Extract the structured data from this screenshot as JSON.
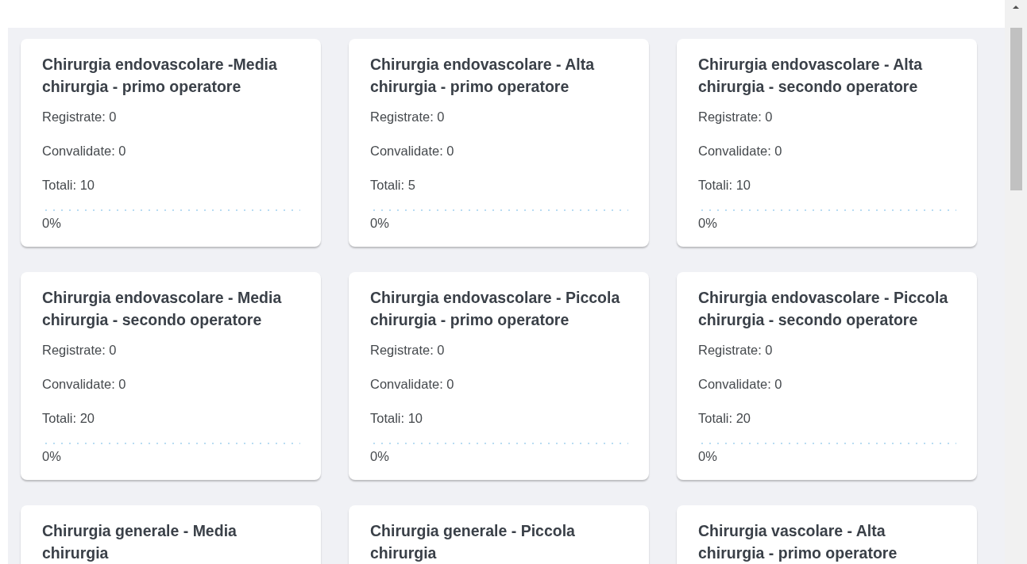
{
  "cards": [
    {
      "title": "Chirurgia endovascolare -Media chirurgia - primo operatore",
      "registrate": "Registrate: 0",
      "convalidate": "Convalidate: 0",
      "totali": "Totali: 10",
      "level": 0,
      "percent": "0%"
    },
    {
      "title": "Chirurgia endovascolare - Alta chirurgia - primo operatore",
      "registrate": "Registrate: 0",
      "convalidate": "Convalidate: 0",
      "totali": "Totali: 5",
      "level": 0,
      "percent": "0%"
    },
    {
      "title": "Chirurgia endovascolare - Alta chirurgia - secondo operatore",
      "registrate": "Registrate: 0",
      "convalidate": "Convalidate: 0",
      "totali": "Totali: 10",
      "level": 0,
      "percent": "0%"
    },
    {
      "title": "Chirurgia endovascolare - Media chirurgia - secondo operatore",
      "registrate": "Registrate: 0",
      "convalidate": "Convalidate: 0",
      "totali": "Totali: 20",
      "level": 0,
      "percent": "0%"
    },
    {
      "title": "Chirurgia endovascolare - Piccola chirurgia - primo operatore",
      "registrate": "Registrate: 0",
      "convalidate": "Convalidate: 0",
      "totali": "Totali: 10",
      "level": 0,
      "percent": "0%"
    },
    {
      "title": "Chirurgia endovascolare - Piccola chirurgia - secondo operatore",
      "registrate": "Registrate: 0",
      "convalidate": "Convalidate: 0",
      "totali": "Totali: 20",
      "level": 0,
      "percent": "0%"
    },
    {
      "title": "Chirurgia generale - Media chirurgia"
    },
    {
      "title": "Chirurgia generale - Piccola chirurgia"
    },
    {
      "title": "Chirurgia vascolare - Alta chirurgia - primo operatore"
    }
  ]
}
